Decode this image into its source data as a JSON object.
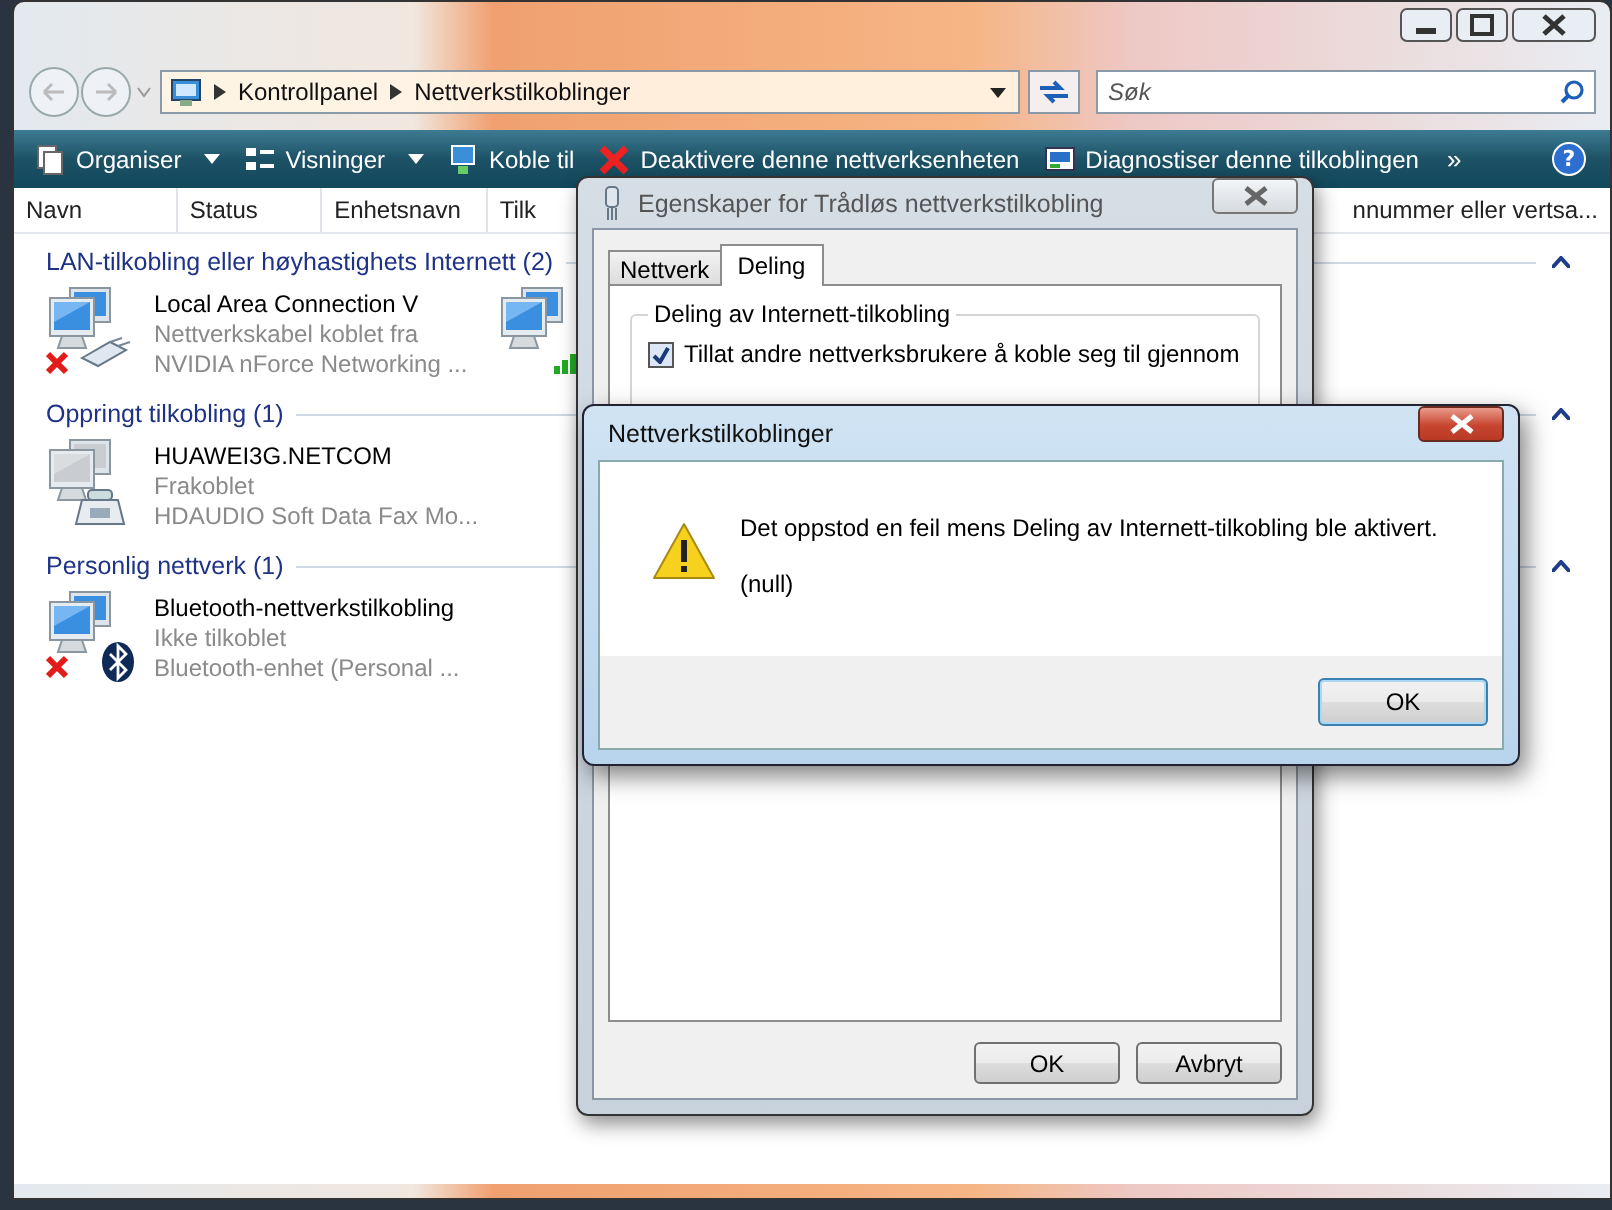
{
  "explorer": {
    "breadcrumbs": [
      "Kontrollpanel",
      "Nettverkstilkoblinger"
    ],
    "search": {
      "placeholder": "Søk"
    },
    "toolbar": [
      {
        "label": "Organiser",
        "kind": "organize",
        "dropdown": true
      },
      {
        "label": "Visninger",
        "kind": "views",
        "dropdown": true
      },
      {
        "label": "Koble til",
        "kind": "connect",
        "dropdown": false
      },
      {
        "label": "Deaktivere denne nettverksenheten",
        "kind": "disable",
        "dropdown": false
      },
      {
        "label": "Diagnostiser denne tilkoblingen",
        "kind": "diagnose",
        "dropdown": false
      }
    ],
    "toolbar_more": "»",
    "help": "?",
    "columns": [
      "Navn",
      "Status",
      "Enhetsnavn",
      "Tilk",
      "nnummer eller vertsa..."
    ],
    "groups": [
      {
        "title": "LAN-tilkobling eller høyhastighets Internett (2)",
        "expanded": true,
        "items": [
          {
            "kind": "cable",
            "disconnected": true,
            "name": "Local Area Connection V",
            "status": "Nettverkskabel koblet fra",
            "device": "NVIDIA nForce Networking ..."
          },
          {
            "kind": "wireless",
            "disconnected": false
          }
        ]
      },
      {
        "title": "Oppringt tilkobling (1)",
        "expanded": true,
        "items": [
          {
            "kind": "modem",
            "disconnected": false,
            "name": "HUAWEI3G.NETCOM",
            "status": "Frakoblet",
            "device": "HDAUDIO Soft Data Fax Mo..."
          }
        ]
      },
      {
        "title": "Personlig nettverk (1)",
        "expanded": true,
        "items": [
          {
            "kind": "bluetooth",
            "disconnected": true,
            "name": "Bluetooth-nettverkstilkobling",
            "status": "Ikke tilkoblet",
            "device": "Bluetooth-enhet (Personal ..."
          }
        ]
      }
    ]
  },
  "properties_dialog": {
    "title": "Egenskaper for Trådløs nettverkstilkobling",
    "tabs": [
      {
        "label": "Nettverk",
        "selected": false
      },
      {
        "label": "Deling",
        "selected": true
      }
    ],
    "group_title": "Deling av Internett-tilkobling",
    "checkbox": {
      "label": "Tillat andre nettverksbrukere å koble seg til gjennom",
      "checked": true
    },
    "buttons": [
      "OK",
      "Avbryt"
    ]
  },
  "error_dialog": {
    "title": "Nettverkstilkoblinger",
    "message": "Det oppstod en feil mens Deling av Internett-tilkobling ble aktivert.",
    "detail": "(null)",
    "button": "OK"
  }
}
